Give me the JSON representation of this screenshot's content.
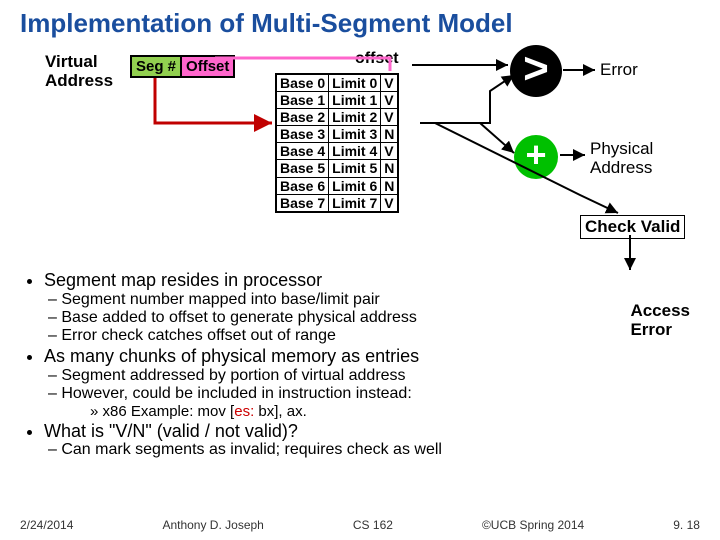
{
  "title": "Implementation of Multi-Segment Model",
  "va": {
    "label1": "Virtual",
    "label2": "Address",
    "seg": "Seg #",
    "off": "Offset"
  },
  "offset_label": "offset",
  "table": [
    [
      "Base 0",
      "Limit 0",
      "V"
    ],
    [
      "Base 1",
      "Limit 1",
      "V"
    ],
    [
      "Base 2",
      "Limit 2",
      "V"
    ],
    [
      "Base 3",
      "Limit 3",
      "N"
    ],
    [
      "Base 4",
      "Limit 4",
      "V"
    ],
    [
      "Base 5",
      "Limit 5",
      "N"
    ],
    [
      "Base 6",
      "Limit 6",
      "N"
    ],
    [
      "Base 7",
      "Limit 7",
      "V"
    ]
  ],
  "ops": {
    "gt": ">",
    "plus": "+"
  },
  "labels": {
    "error": "Error",
    "phys1": "Physical",
    "phys2": "Address",
    "checkvalid": "Check Valid",
    "access": "Access",
    "accerr": "Error"
  },
  "bul": {
    "b1": "Segment map resides in processor",
    "s1": "– Segment number mapped into base/limit pair",
    "s2": "– Base added to offset to generate physical address",
    "s3": "– Error check catches offset out of range",
    "b2": "As many chunks of physical memory as entries",
    "s4": "– Segment addressed by portion of virtual address",
    "s5": "– However, could be included in instruction instead:",
    "s6a": "» x86 Example: mov [",
    "s6b": "es:",
    "s6c": " bx], ax.",
    "b3": "What is \"V/N\" (valid / not valid)?",
    "s7": "– Can mark segments as invalid; requires check as well"
  },
  "footer": {
    "date": "2/24/2014",
    "author": "Anthony D. Joseph",
    "course": "CS 162",
    "copy": "©UCB Spring 2014",
    "page": "9. 18"
  }
}
